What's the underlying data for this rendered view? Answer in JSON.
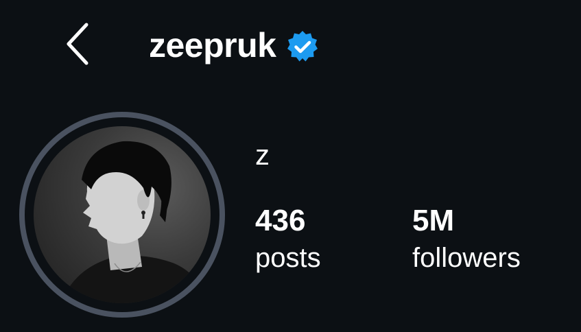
{
  "header": {
    "back_icon": "chevron-left-icon",
    "username": "zeepruk",
    "verified_icon": "verified-badge-icon",
    "verified_color": "#1d9bf0"
  },
  "profile": {
    "avatar_ring_color": "#4a5260",
    "display_name": "z",
    "stats": {
      "posts_count": "436",
      "posts_label": "posts",
      "followers_count": "5M",
      "followers_label": "followers"
    }
  },
  "theme": {
    "background": "#0c1014",
    "text": "#ffffff"
  }
}
